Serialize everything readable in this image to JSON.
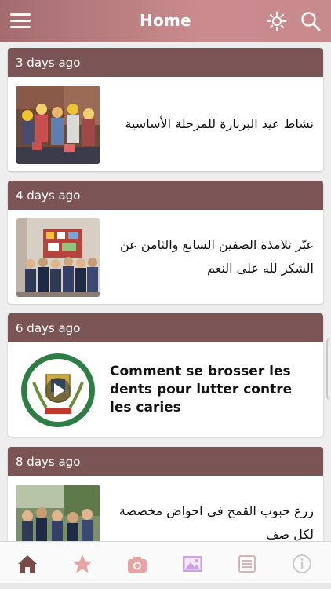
{
  "header": {
    "title": "Home"
  },
  "posts": [
    {
      "date": "3 days ago",
      "title": "نشاط عيد البربارة للمرحلة الأساسية",
      "lang": "ar"
    },
    {
      "date": "4 days ago",
      "title": "عبّر تلامذة الصفين السابع والثامن عن الشكر لله على النعم",
      "lang": "ar"
    },
    {
      "date": "6 days ago",
      "title": "Comment se brosser les dents pour lutter contre les caries",
      "lang": "fr"
    },
    {
      "date": "8 days ago",
      "title": "زرع حبوب القمح في احواض مخصصة لكل صف",
      "lang": "ar"
    }
  ],
  "tabs": [
    {
      "icon": "home-icon",
      "color": "#7b4a46"
    },
    {
      "icon": "star-icon",
      "color": "#e8a3a0"
    },
    {
      "icon": "camera-icon",
      "color": "#e8a3a0"
    },
    {
      "icon": "gallery-icon",
      "color": "#c9a3dc"
    },
    {
      "icon": "list-icon",
      "color": "#d9b3b3"
    },
    {
      "icon": "info-icon",
      "color": "#c8c8c8"
    }
  ],
  "colors": {
    "header": "#b67b7e",
    "date_bar": "#7b5556"
  }
}
